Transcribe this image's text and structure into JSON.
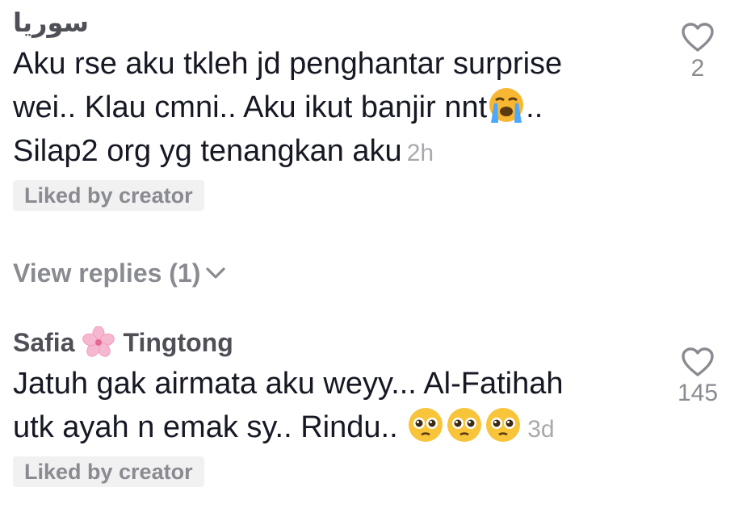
{
  "comments": [
    {
      "username": "سوريا",
      "text_line1": "Aku rse aku tkleh jd penghantar surprise",
      "text_line2a": "wei.. Klau cmni.. Aku ikut banjir nnt",
      "text_line2b": "..",
      "text_line3": "Silap2 org yg tenangkan aku",
      "time": "2h",
      "badge": "Liked by creator",
      "like_count": "2"
    },
    {
      "username_first": "Safia",
      "username_last": "Tingtong",
      "text_line1": "Jatuh gak airmata aku weyy... Al-Fatihah",
      "text_line2": "utk ayah n emak sy.. Rindu..",
      "time": "3d",
      "badge": "Liked by creator",
      "like_count": "145"
    }
  ],
  "view_replies": "View replies (1)",
  "icons": {
    "like": "heart-outline-icon",
    "expand": "chevron-down-icon",
    "crying": "loudly-crying-face-emoji",
    "pleading": "pleading-face-emoji",
    "blossom": "cherry-blossom-emoji"
  },
  "colors": {
    "text": "#161823",
    "muted": "#8a8b91",
    "badge_bg": "#f1f1f2"
  }
}
